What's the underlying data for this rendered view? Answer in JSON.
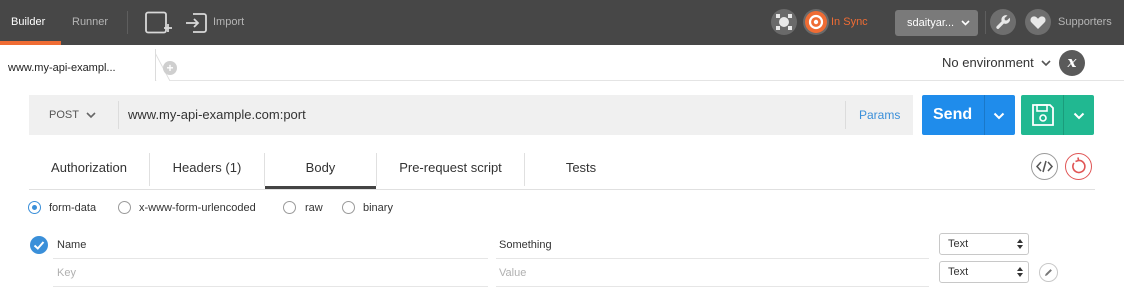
{
  "topbar": {
    "tabs": [
      "Builder",
      "Runner"
    ],
    "import_label": "Import",
    "sync_label": "In Sync",
    "user_label": "sdaityar...",
    "supporters_label": "Supporters",
    "accent_color": "#ef6c34"
  },
  "request_tab": {
    "label": "www.my-api-exampl..."
  },
  "environment": {
    "label": "No environment"
  },
  "request": {
    "method": "POST",
    "url": "www.my-api-example.com:port",
    "params_label": "Params",
    "send_label": "Send",
    "send_color": "#1f8ceb",
    "save_color": "#21b891"
  },
  "tabs": [
    "Authorization",
    "Headers (1)",
    "Body",
    "Pre-request script",
    "Tests"
  ],
  "active_tab": "Body",
  "body_types": [
    "form-data",
    "x-www-form-urlencoded",
    "raw",
    "binary"
  ],
  "selected_body_type": "form-data",
  "form_rows": [
    {
      "key": "Name",
      "value": "Something",
      "type": "Text",
      "checked": true
    },
    {
      "key_placeholder": "Key",
      "value_placeholder": "Value",
      "type": "Text"
    }
  ]
}
